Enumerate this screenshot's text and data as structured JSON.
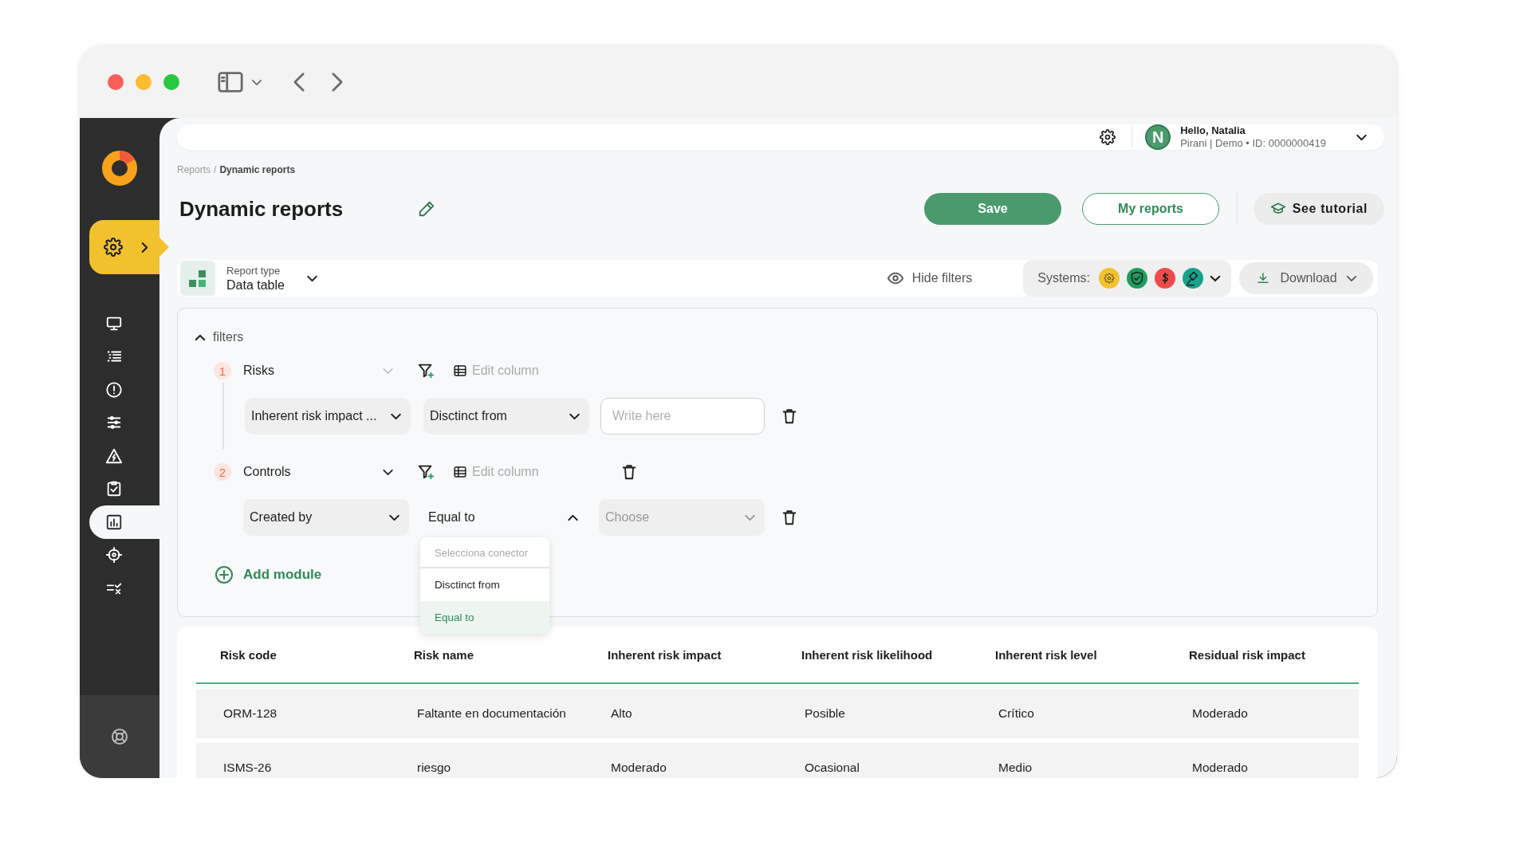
{
  "sidebar": {
    "items": [
      {
        "kind": "monitor",
        "selected": false
      },
      {
        "kind": "list",
        "selected": false
      },
      {
        "kind": "alert",
        "selected": false
      },
      {
        "kind": "sliders",
        "selected": false
      },
      {
        "kind": "warning",
        "selected": false
      },
      {
        "kind": "clipboard",
        "selected": false
      },
      {
        "kind": "chart",
        "selected": true
      },
      {
        "kind": "target",
        "selected": false
      },
      {
        "kind": "checklist",
        "selected": false
      }
    ]
  },
  "top_bar": {
    "avatar_initial": "N",
    "greeting": "Hello, Natalia",
    "account": "Pirani | Demo • ID: 0000000419"
  },
  "breadcrumb": {
    "items": [
      "Reports",
      "Dynamic reports"
    ],
    "separator": "/"
  },
  "page_title": "Dynamic reports",
  "actions": [
    {
      "kind": "primary",
      "label": "Save"
    },
    {
      "kind": "outline",
      "label": "My reports"
    },
    {
      "kind": "tutorial",
      "label": "See tutorial"
    }
  ],
  "report_type": {
    "label": "Report type",
    "value": "Data table"
  },
  "hide_filters": "Hide filters",
  "systems": {
    "label": "Systems:",
    "items": [
      {
        "kind": "gear",
        "color": "#f2c12e"
      },
      {
        "kind": "shield",
        "color": "#1e9e5e"
      },
      {
        "kind": "dollar",
        "color": "#ef4b4b"
      },
      {
        "kind": "gavel",
        "color": "#16a38a"
      }
    ]
  },
  "download": "Download",
  "filters": {
    "label": "filters",
    "expanded": true,
    "modules": [
      {
        "number": "1",
        "name": "Risks",
        "disabled": true,
        "removable": false,
        "edit_label": "Edit column",
        "conditions": [
          {
            "field": "Inherent risk impact ...",
            "operator": "Disctinct from",
            "operator_open": false,
            "value": {
              "kind": "input",
              "placeholder": "Write here"
            }
          }
        ]
      },
      {
        "number": "2",
        "name": "Controls",
        "disabled": false,
        "removable": true,
        "edit_label": "Edit column",
        "conditions": [
          {
            "field": "Created by",
            "operator": "Equal to",
            "operator_open": true,
            "value": {
              "kind": "select",
              "placeholder": "Choose"
            },
            "menu": {
              "header": "Selecciona conector",
              "options": [
                {
                  "label": "Disctinct from",
                  "selected": false
                },
                {
                  "label": "Equal to",
                  "selected": true
                }
              ]
            }
          }
        ]
      }
    ],
    "add_label": "Add module"
  },
  "table": {
    "columns": [
      "Risk code",
      "Risk name",
      "Inherent risk impact",
      "Inherent risk likelihood",
      "Inherent risk level",
      "Residual risk impact"
    ],
    "rows": [
      [
        "ORM-128",
        "Faltante en documentación",
        "Alto",
        "Posible",
        "Crítico",
        "Moderado"
      ],
      [
        "ISMS-26",
        "riesgo",
        "Moderado",
        "Ocasional",
        "Medio",
        "Moderado"
      ]
    ]
  }
}
